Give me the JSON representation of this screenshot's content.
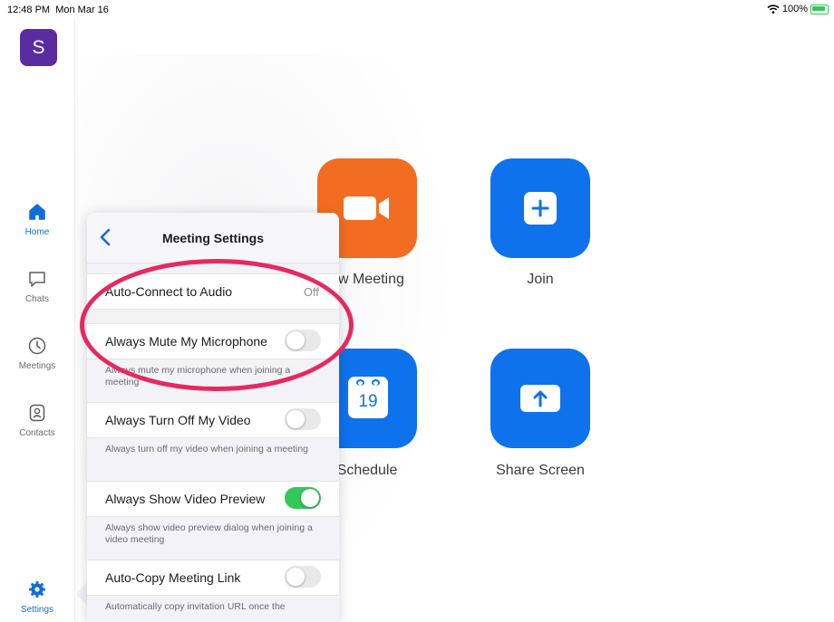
{
  "status_bar": {
    "time": "12:48 PM",
    "date": "Mon Mar 16",
    "battery": "100%"
  },
  "sidebar": {
    "avatar_letter": "S",
    "items": [
      {
        "label": "Home",
        "icon": "home-icon",
        "active": true
      },
      {
        "label": "Chats",
        "icon": "chat-bubble-icon",
        "active": false
      },
      {
        "label": "Meetings",
        "icon": "clock-icon",
        "active": false
      },
      {
        "label": "Contacts",
        "icon": "contact-card-icon",
        "active": false
      },
      {
        "label": "Settings",
        "icon": "gear-icon",
        "active": true
      }
    ]
  },
  "home": {
    "tiles": [
      {
        "label": "New Meeting",
        "visible_label": "ew Meeting",
        "icon": "video-camera-icon",
        "color": "#f26d21"
      },
      {
        "label": "Join",
        "icon": "plus-icon",
        "color": "#0e72ed"
      },
      {
        "label": "Schedule",
        "icon": "calendar-icon",
        "color": "#0e72ed",
        "calendar_day": "19"
      },
      {
        "label": "Share Screen",
        "icon": "share-up-arrow-icon",
        "color": "#0e72ed"
      }
    ]
  },
  "settings_panel": {
    "title": "Meeting Settings",
    "rows": [
      {
        "label": "Auto-Connect to Audio",
        "value": "Off"
      },
      {
        "label": "Always Mute My Microphone",
        "toggle": false,
        "description": "Always mute my microphone when joining a meeting"
      },
      {
        "label": "Always Turn Off My Video",
        "toggle": false,
        "description": "Always turn off my video when joining a meeting"
      },
      {
        "label": "Always Show Video Preview",
        "toggle": true,
        "description": "Always show video preview dialog when joining a video meeting"
      },
      {
        "label": "Auto-Copy Meeting Link",
        "toggle": false,
        "description": "Automatically copy invitation URL once the"
      }
    ]
  },
  "colors": {
    "accent": "#0e6ddd",
    "highlight": "#e6295e",
    "toggle_on": "#34c759",
    "brand_orange": "#f26d21"
  }
}
